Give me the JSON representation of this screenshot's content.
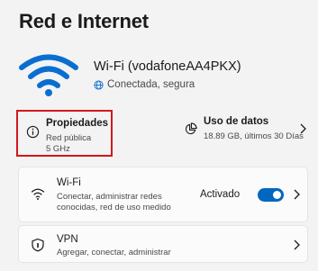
{
  "page": {
    "title": "Red e Internet"
  },
  "network": {
    "name": "Wi-Fi (vodafoneAA4PKX)",
    "status": "Conectada, segura"
  },
  "properties": {
    "title": "Propiedades",
    "line1": "Red pública",
    "line2": "5 GHz",
    "highlight_color": "#d0191c"
  },
  "data_usage": {
    "title": "Uso de datos",
    "detail": "18.89 GB, últimos 30 Días"
  },
  "wifi_card": {
    "title": "Wi-Fi",
    "desc_line1": "Conectar, administrar redes",
    "desc_line2": "conocidas, red de uso medido",
    "toggle_label": "Activado",
    "toggle_on": true,
    "accent": "#0067c0"
  },
  "vpn_card": {
    "title": "VPN",
    "desc": "Agregar, conectar, administrar"
  }
}
